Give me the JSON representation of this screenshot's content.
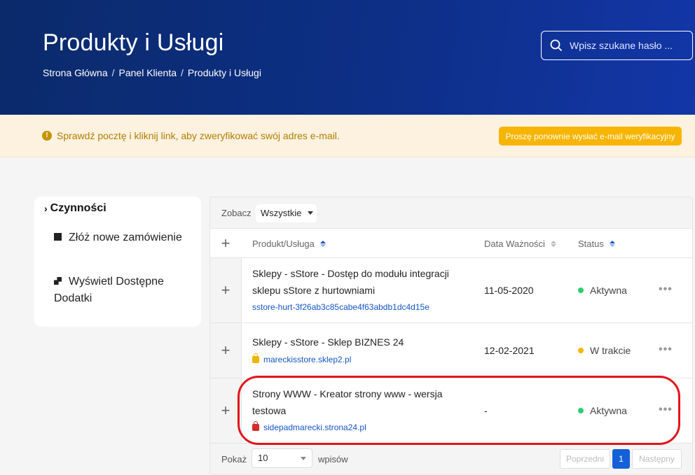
{
  "header": {
    "title": "Produkty i Usługi",
    "breadcrumb": [
      "Strona Główna",
      "Panel Klienta",
      "Produkty i Usługi"
    ],
    "breadcrumb_sep": "/",
    "search_placeholder": "Wpisz szukane hasło ..."
  },
  "alert": {
    "text": "Sprawdź pocztę i kliknij link, aby zweryfikować swój adres e-mail.",
    "button": "Proszę ponownie wysłać e-mail weryfikacyjny",
    "icon": "exclamation-circle-icon"
  },
  "sidebar": {
    "heading": "Czynności",
    "items": [
      {
        "label": "Złóż nowe zamówienie",
        "icon": "cart-icon"
      },
      {
        "label": "Wyświetl Dostępne Dodatki",
        "icon": "addons-icon"
      }
    ]
  },
  "table": {
    "filter_label": "Zobacz",
    "filter_value": "Wszystkie",
    "columns": [
      "Produkt/Usługa",
      "Data Ważności",
      "Status"
    ],
    "rows": [
      {
        "product": "Sklepy - sStore - Dostęp do modułu integracji sklepu sStore z hurtowniami",
        "domain": "sstore-hurt-3f26ab3c85cabe4f63abdb1dc4d15e",
        "date": "11-05-2020",
        "status": "Aktywna",
        "status_color": "#2ecc71",
        "lock": "none"
      },
      {
        "product": "Sklepy - sStore - Sklep BIZNES 24",
        "domain": "mareckisstore.sklep2.pl",
        "date": "12-02-2021",
        "status": "W trakcie",
        "status_color": "#f5b800",
        "lock": "yellow"
      },
      {
        "product": "Strony WWW - Kreator strony www - wersja testowa",
        "domain": "sidepadmarecki.strona24.pl",
        "date": "-",
        "status": "Aktywna",
        "status_color": "#2ecc71",
        "lock": "red"
      }
    ],
    "more_glyph": "•••",
    "plus_glyph": "+"
  },
  "pagination": {
    "show_label": "Pokaż",
    "page_size": "10",
    "entries_label": "wpisów",
    "prev": "Poprzedni",
    "current": "1",
    "next": "Następny"
  }
}
